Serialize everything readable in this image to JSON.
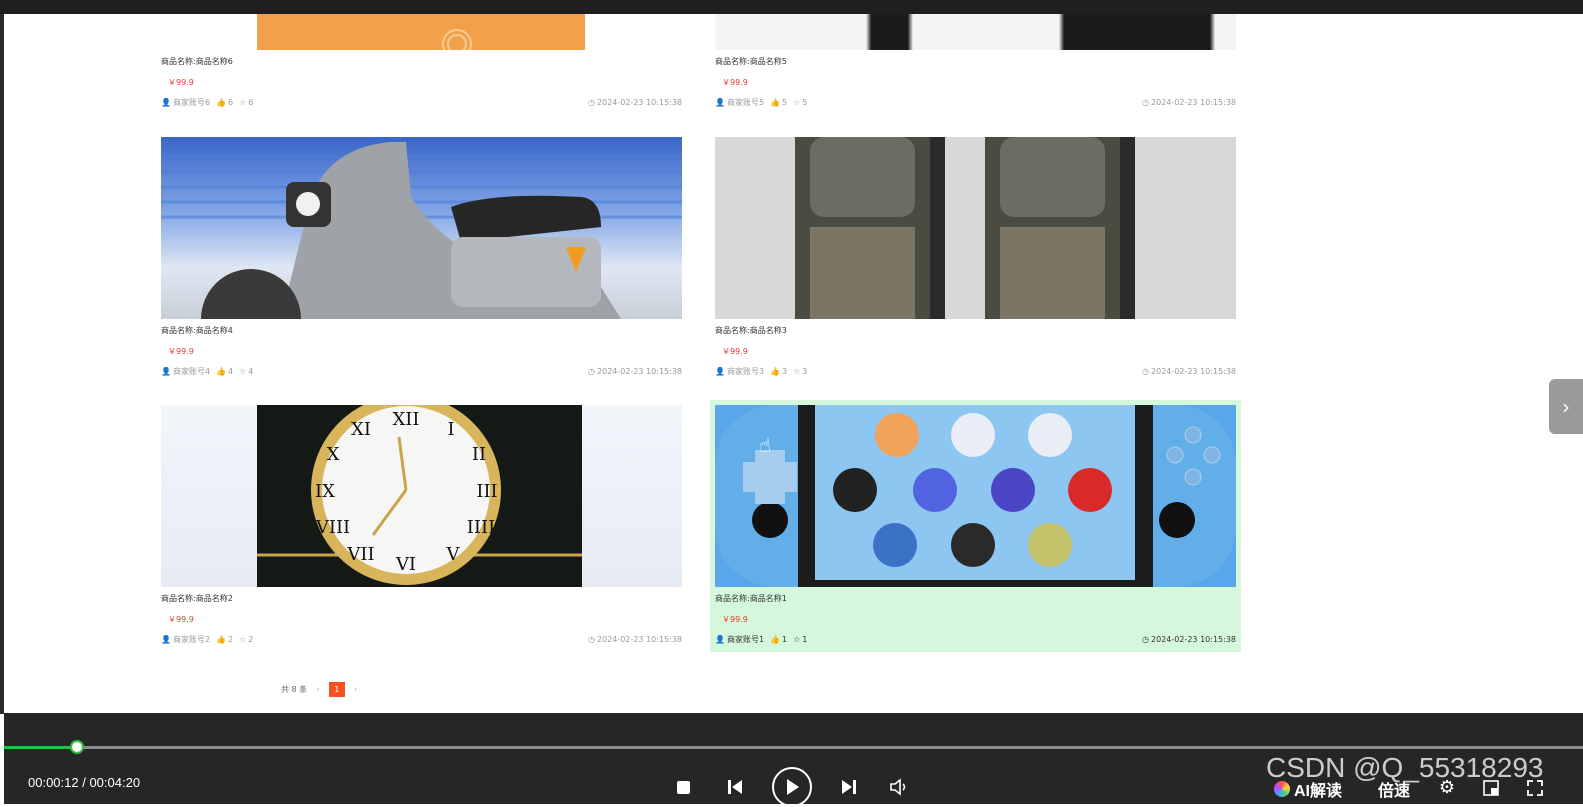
{
  "products": [
    {
      "name": "商品名称:商品名称6",
      "price": "￥99.9",
      "merchant": "商家账号6",
      "likes": "6",
      "favorites": "6",
      "time": "2024-02-23 10:15:38",
      "image_icon": "orange-cloth-image"
    },
    {
      "name": "商品名称:商品名称5",
      "price": "￥99.9",
      "merchant": "商家账号5",
      "likes": "5",
      "favorites": "5",
      "time": "2024-02-23 10:15:38",
      "image_icon": "dark-devices-image"
    },
    {
      "name": "商品名称:商品名称4",
      "price": "￥99.9",
      "merchant": "商家账号4",
      "likes": "4",
      "favorites": "4",
      "time": "2024-02-23 10:15:38",
      "image_icon": "scooter-image"
    },
    {
      "name": "商品名称:商品名称3",
      "price": "￥99.9",
      "merchant": "商家账号3",
      "likes": "3",
      "favorites": "3",
      "time": "2024-02-23 10:15:38",
      "image_icon": "speakers-image"
    },
    {
      "name": "商品名称:商品名称2",
      "price": "￥99.9",
      "merchant": "商家账号2",
      "likes": "2",
      "favorites": "2",
      "time": "2024-02-23 10:15:38",
      "image_icon": "clock-image"
    },
    {
      "name": "商品名称:商品名称1",
      "price": "￥99.9",
      "merchant": "商家账号1",
      "likes": "1",
      "favorites": "1",
      "time": "2024-02-23 10:15:38",
      "image_icon": "game-console-image"
    }
  ],
  "pagination": {
    "total": "共 8 条",
    "prev": "‹",
    "current": "1",
    "next": "›"
  },
  "player": {
    "time": "00:00:12 / 00:04:20",
    "progress": 0.046,
    "ai_label": "AI解读",
    "speed_label": "倍速",
    "watermark": "CSDN @Q_55318293"
  },
  "colors": {
    "accent_green": "#27c33f",
    "price_red": "#e53935",
    "page_active": "#f4511e",
    "hover_bg": "#d5f8dc"
  }
}
